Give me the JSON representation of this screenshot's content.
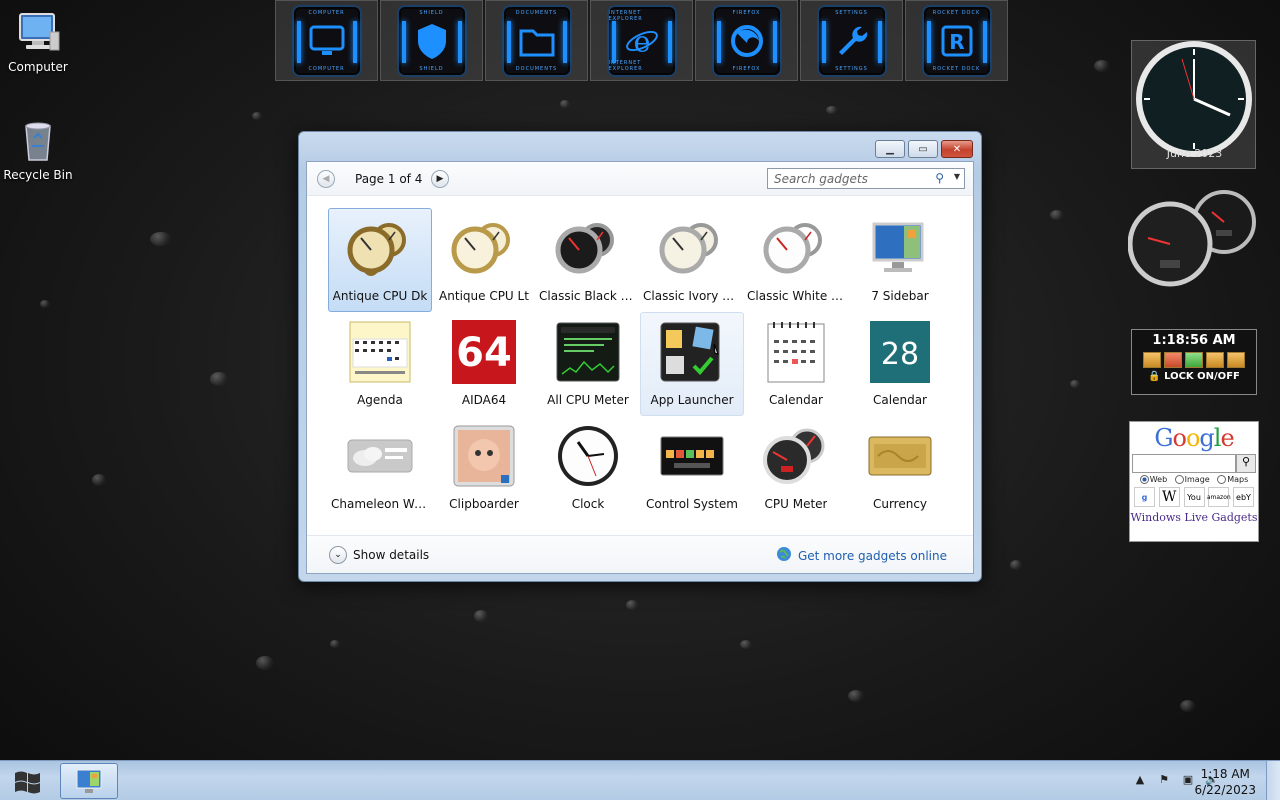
{
  "desktop": {
    "icons": [
      {
        "label": "Computer",
        "icon": "computer-icon"
      },
      {
        "label": "Recycle Bin",
        "icon": "recycle-bin-icon"
      }
    ]
  },
  "dock": {
    "items": [
      {
        "caption": "COMPUTER",
        "icon": "monitor-icon"
      },
      {
        "caption": "SHIELD",
        "icon": "shield-icon"
      },
      {
        "caption": "DOCUMENTS",
        "icon": "folder-icon"
      },
      {
        "caption": "INTERNET EXPLORER",
        "icon": "ie-icon"
      },
      {
        "caption": "FIREFOX",
        "icon": "firefox-icon"
      },
      {
        "caption": "SETTINGS",
        "icon": "wrench-icon"
      },
      {
        "caption": "ROCKET DOCK",
        "icon": "rocketdock-icon"
      }
    ]
  },
  "gallery": {
    "page_label": "Page 1 of 4",
    "search_placeholder": "Search gadgets",
    "items": [
      {
        "label": "Antique CPU Dk",
        "state": "selected"
      },
      {
        "label": "Antique CPU Lt"
      },
      {
        "label": "Classic Black C..."
      },
      {
        "label": "Classic Ivory CPU"
      },
      {
        "label": "Classic White C..."
      },
      {
        "label": "7 Sidebar"
      },
      {
        "label": "Agenda"
      },
      {
        "label": "AIDA64"
      },
      {
        "label": "All CPU Meter"
      },
      {
        "label": "App Launcher",
        "state": "hover"
      },
      {
        "label": "Calendar"
      },
      {
        "label": "Calendar"
      },
      {
        "label": "Chameleon We..."
      },
      {
        "label": "Clipboarder"
      },
      {
        "label": "Clock"
      },
      {
        "label": "Control System"
      },
      {
        "label": "CPU Meter"
      },
      {
        "label": "Currency"
      }
    ],
    "show_details": "Show details",
    "get_more": "Get more gadgets online"
  },
  "gadgets": {
    "clock_date": "June 2023",
    "lock_time": "1:18:56 AM",
    "lock_label": "LOCK ON/OFF",
    "google_logo": "Google",
    "google_radios": [
      "Web",
      "Image",
      "Maps"
    ],
    "google_footer": "Windows Live Gadgets",
    "google_links": [
      "W",
      "You",
      "amazon",
      "ebY"
    ]
  },
  "taskbar": {
    "time": "1:18 AM",
    "date": "6/22/2023"
  },
  "colors": {
    "accent": "#1e8fff",
    "link": "#1f5fb0",
    "selection": "#c4dcf5"
  }
}
